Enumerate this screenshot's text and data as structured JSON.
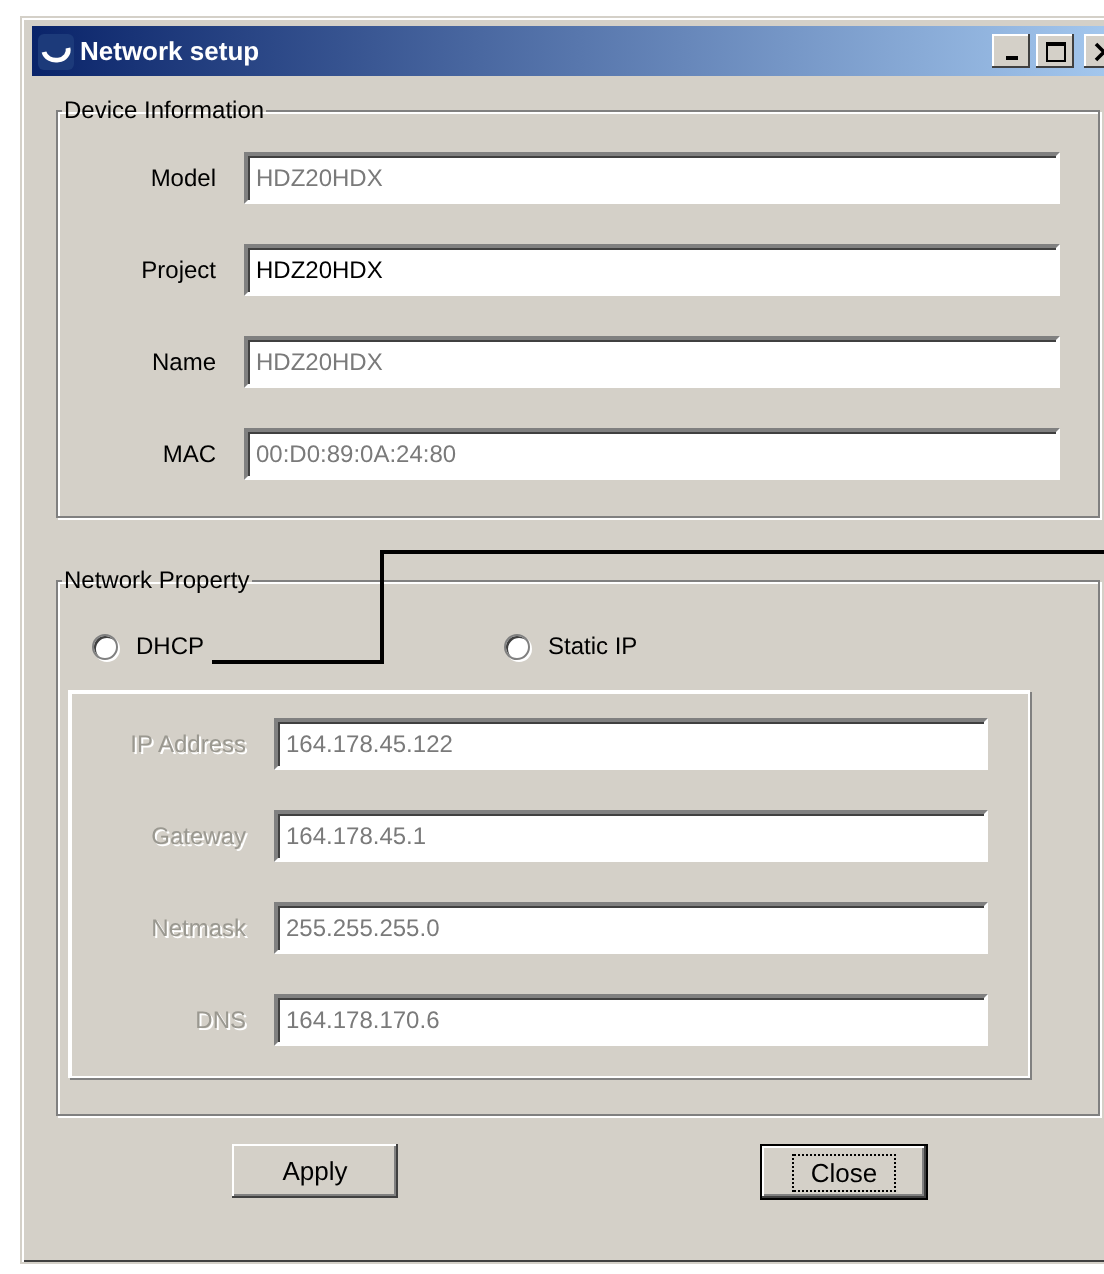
{
  "window": {
    "title": "Network setup"
  },
  "device_information": {
    "title": "Device Information",
    "fields": [
      {
        "label": "Model",
        "value": "HDZ20HDX",
        "disabled": true
      },
      {
        "label": "Project",
        "value": "HDZ20HDX",
        "disabled": false
      },
      {
        "label": "Name",
        "value": "HDZ20HDX",
        "disabled": true
      },
      {
        "label": "MAC",
        "value": "00:D0:89:0A:24:80",
        "disabled": true
      }
    ]
  },
  "network_property": {
    "title": "Network Property",
    "modes": [
      {
        "label": "DHCP",
        "selected": false
      },
      {
        "label": "Static IP",
        "selected": false
      }
    ],
    "fields": [
      {
        "label": "IP Address",
        "value": "164.178.45.122",
        "disabled": true
      },
      {
        "label": "Gateway",
        "value": "164.178.45.1",
        "disabled": true
      },
      {
        "label": "Netmask",
        "value": "255.255.255.0",
        "disabled": true
      },
      {
        "label": "DNS",
        "value": "164.178.170.6",
        "disabled": true
      }
    ]
  },
  "buttons": [
    {
      "label": "Apply",
      "default": false
    },
    {
      "label": "Close",
      "default": true
    }
  ]
}
